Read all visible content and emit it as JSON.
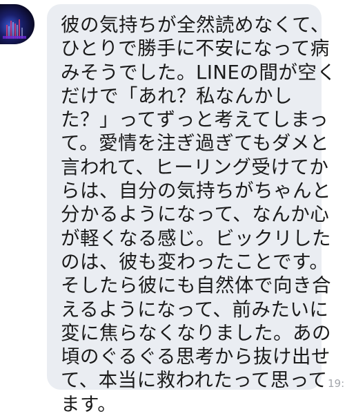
{
  "chat": {
    "sender_avatar_icon": "fountain-night-avatar-icon",
    "message": {
      "text": "彼の気持ちが全然読めなくて、\nひとりで勝手に不安になって病\nみそうでした。LINEの間が空く\nだけで「あれ？私なんかし\nた？」ってずっと考えてしまっ\nて。愛情を注ぎ過ぎてもダメと\n言われて、ヒーリング受けてか\nらは、自分の気持ちがちゃんと\n分かるようになって、なんか心\nが軽くなる感じ。ビックリした\nのは、彼も変わったことです。\nそしたら彼にも自然体で向き合\nえるようになって、前みたいに\n変に焦らなくなりました。あの\n頃のぐるぐる思考から抜け出せ\nて、本当に救われたって思って\nます。",
      "timestamp": "19:"
    },
    "colors": {
      "bubble": "#eaedf2",
      "text": "#1a1a1a",
      "timestamp": "#a3a6ab",
      "background": "#ffffff"
    }
  }
}
